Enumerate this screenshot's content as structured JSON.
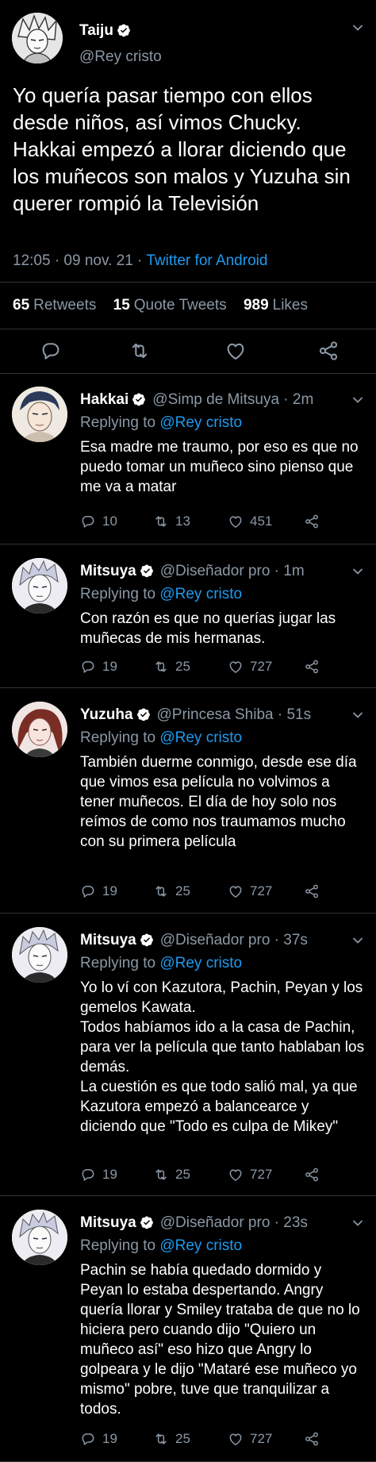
{
  "main_tweet": {
    "name": "Taiju",
    "handle": "@Rey cristo",
    "text": "Yo quería pasar tiempo con ellos desde niños, así vimos Chucky. Hakkai empezó a llorar diciendo que los muñecos son malos y Yuzuha sin querer rompió la Televisión",
    "time": "12:05 · 09 nov. 21 · ",
    "source": "Twitter for Android",
    "retweets_count": "65",
    "retweets_label": "Retweets",
    "quotes_count": "15",
    "quotes_label": "Quote Tweets",
    "likes_count": "989",
    "likes_label": "Likes",
    "icons": [
      "reply-icon",
      "retweet-icon",
      "like-icon",
      "share-icon"
    ]
  },
  "replies": [
    {
      "name": "Hakkai",
      "handle": "@Simp de Mitsuya · 2m",
      "replying_label": "Replying to",
      "replying_to": "@Rey cristo",
      "text": "Esa madre me traumo, por eso es que no puedo tomar un muñeco sino pienso que me va a matar",
      "replies": "10",
      "retweets": "13",
      "likes": "451"
    },
    {
      "name": "Mitsuya",
      "handle": "@Diseñador pro · 1m",
      "replying_label": "Replying to",
      "replying_to": "@Rey cristo",
      "text": "Con razón es que no querías jugar las muñecas de mis hermanas.",
      "replies": "19",
      "retweets": "25",
      "likes": "727"
    },
    {
      "name": "Yuzuha",
      "handle": "@Princesa Shiba · 51s",
      "replying_label": "Replying to",
      "replying_to": "@Rey cristo",
      "text": "También duerme conmigo, desde ese día que vimos esa película no volvimos a tener muñecos. El día de hoy solo nos reímos de como nos traumamos mucho con su primera película",
      "replies": "19",
      "retweets": "25",
      "likes": "727"
    },
    {
      "name": "Mitsuya",
      "handle": "@Diseñador pro · 37s",
      "replying_label": "Replying to",
      "replying_to": "@Rey cristo",
      "text": "Yo lo ví con Kazutora, Pachin, Peyan y los gemelos Kawata.\nTodos habíamos ido a la casa de Pachin, para ver la película que tanto hablaban los demás.\nLa cuestión es que todo salió mal, ya que Kazutora empezó a balancearce y diciendo que \"Todo es culpa de Mikey\"",
      "replies": "19",
      "retweets": "25",
      "likes": "727"
    },
    {
      "name": "Mitsuya",
      "handle": "@Diseñador pro · 23s",
      "replying_label": "Replying to",
      "replying_to": "@Rey cristo",
      "text": "Pachin se había quedado dormido y Peyan lo estaba despertando. Angry quería llorar y Smiley trataba de que no lo hiciera pero  cuando dijo \"Quiero un muñeco así\" eso hizo que Angry lo golpeara y le dijo \"Mataré ese muñeco yo mismo\" pobre, tuve que tranquilizar a todos.",
      "replies": "19",
      "retweets": "25",
      "likes": "727"
    }
  ],
  "colors": {
    "background": "#000000",
    "text": "#ffffff",
    "muted": "#8b98a5",
    "link": "#1d9bf0",
    "divider": "#2f3336"
  }
}
